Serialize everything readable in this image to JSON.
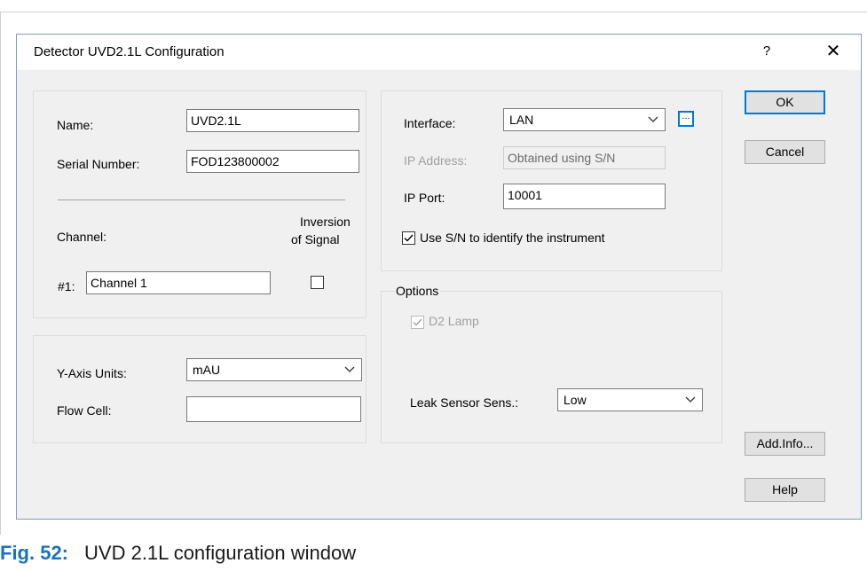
{
  "dialog": {
    "title": "Detector UVD2.1L Configuration",
    "help_glyph": "?",
    "close_glyph": "✕"
  },
  "left_panel": {
    "name_label": "Name:",
    "name_value": "UVD2.1L",
    "serial_label": "Serial Number:",
    "serial_value": "FOD123800002",
    "channel_label": "Channel:",
    "inversion_label_1": "Inversion",
    "inversion_label_2": "of Signal",
    "channel_number": "#1:",
    "channel_value": "Channel 1",
    "inversion_checked": false
  },
  "units_panel": {
    "y_axis_label": "Y-Axis Units:",
    "y_axis_value": "mAU",
    "flow_cell_label": "Flow Cell:",
    "flow_cell_value": ""
  },
  "interface_panel": {
    "interface_label": "Interface:",
    "interface_value": "LAN",
    "ip_address_label": "IP Address:",
    "ip_address_value": "Obtained using S/N",
    "ip_port_label": "IP Port:",
    "ip_port_value": "10001",
    "use_sn_label": "Use S/N to identify the instrument",
    "use_sn_checked": true
  },
  "options_panel": {
    "group_label": "Options",
    "d2_lamp_label": "D2 Lamp",
    "d2_lamp_checked": true,
    "leak_label": "Leak Sensor Sens.:",
    "leak_value": "Low"
  },
  "buttons": {
    "ok": "OK",
    "cancel": "Cancel",
    "add_info": "Add.Info...",
    "help": "Help"
  },
  "caption": {
    "fig": "Fig. 52:",
    "text": "UVD 2.1L configuration window"
  },
  "colors": {
    "accent": "#0078d7",
    "caption_blue": "#1b72bd",
    "window_bg": "#f0f0f0"
  }
}
